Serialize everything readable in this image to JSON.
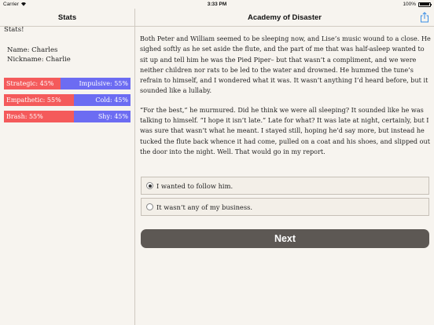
{
  "status_bar": {
    "carrier": "Carrier",
    "time": "3:33 PM",
    "battery": "100%"
  },
  "sidebar": {
    "title": "Stats",
    "heading": "Stats!",
    "name_line": "Name: Charles",
    "nickname_line": "Nickname: Charlie",
    "stats": [
      {
        "left_label": "Strategic: 45%",
        "left_value": 45,
        "right_label": "Impulsive: 55%",
        "right_value": 55
      },
      {
        "left_label": "Empathetic: 55%",
        "left_value": 55,
        "right_label": "Cold: 45%",
        "right_value": 45
      },
      {
        "left_label": "Brash: 55%",
        "left_value": 55,
        "right_label": "Shy: 45%",
        "right_value": 45
      }
    ],
    "colors": {
      "left": "#f45a5b",
      "right": "#6c6cf2"
    }
  },
  "main": {
    "title": "Academy of Disaster",
    "share_icon": "share-icon",
    "paragraphs": [
      "Both Peter and William seemed to be sleeping now, and Lise’s music wound to a close. He sighed softly as he set aside the flute, and the part of me that was half-asleep wanted to sit up and tell him he was the Pied Piper– but that wasn’t a compliment, and we were neither children nor rats to be led to the water and drowned. He hummed the tune’s refrain to himself, and I wondered what it was. It wasn’t anything I’d heard before, but it sounded like a lullaby.",
      "“For the best,” he murmured. Did he think we were all sleeping? It sounded like he was talking to himself. “I hope it isn’t late.” Late for what? It was late at night, certainly, but I was sure that wasn’t what he meant. I stayed still, hoping he’d say more, but instead he tucked the flute back whence it had come, pulled on a coat and his shoes, and slipped out the door into the night. Well. That would go in my report."
    ],
    "choices": [
      {
        "label": "I wanted to follow him.",
        "selected": true
      },
      {
        "label": "It wasn’t any of my business.",
        "selected": false
      }
    ],
    "next_label": "Next"
  }
}
